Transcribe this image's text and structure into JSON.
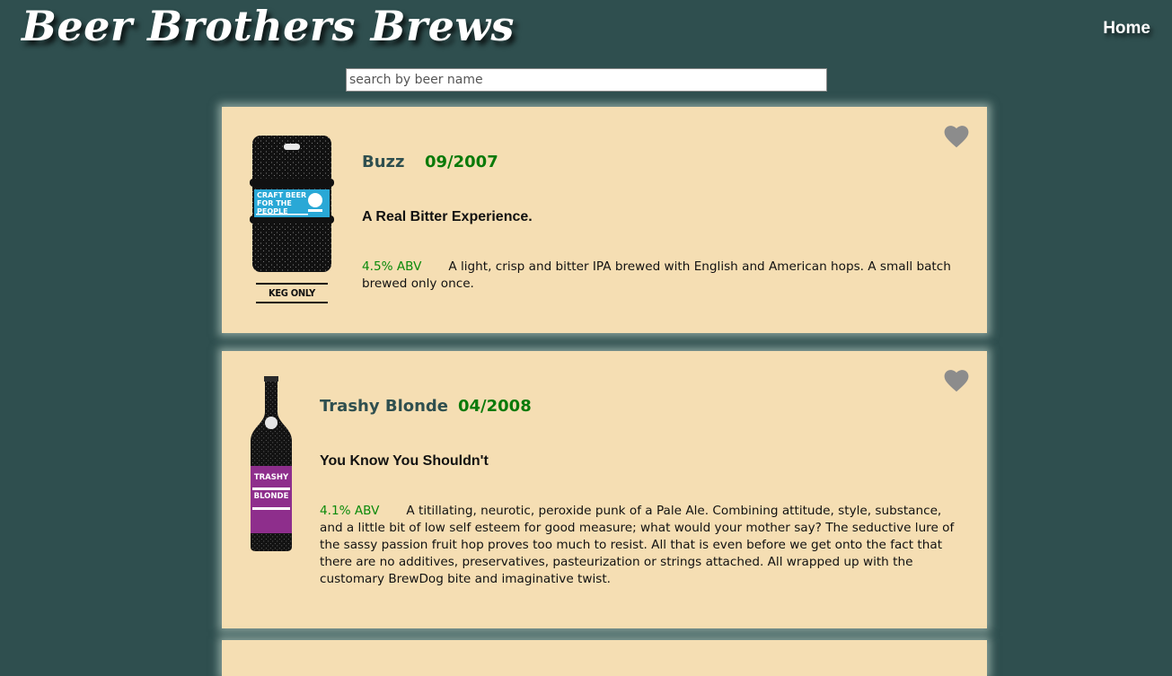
{
  "header": {
    "brand": "Beer Brothers Brews",
    "nav_home": "Home"
  },
  "search": {
    "placeholder": "search by beer name"
  },
  "beers": [
    {
      "name": "Buzz",
      "first_brewed": "09/2007",
      "tagline": "A Real Bitter Experience.",
      "abv": "4.5% ABV",
      "description": "A light, crisp and bitter IPA brewed with English and American hops. A small batch brewed only once.",
      "image_label_lines": [
        "CRAFT BEER",
        "FOR THE",
        "PEOPLE"
      ],
      "image_footer": "KEG ONLY",
      "image_type": "keg",
      "favorite_icon": "heart-icon"
    },
    {
      "name": "Trashy Blonde",
      "first_brewed": "04/2008",
      "tagline": "You Know You Shouldn't",
      "abv": "4.1% ABV",
      "description": "A titillating, neurotic, peroxide punk of a Pale Ale. Combining attitude, style, substance, and a little bit of low self esteem for good measure; what would your mother say? The seductive lure of the sassy passion fruit hop proves too much to resist. All that is even before we get onto the fact that there are no additives, preservatives, pasteurization or strings attached. All wrapped up with the customary BrewDog bite and imaginative twist.",
      "image_label_lines": [
        "TRASHY",
        "BLONDE"
      ],
      "image_type": "bottle",
      "favorite_icon": "heart-icon"
    }
  ],
  "colors": {
    "background": "#2f4f4f",
    "card": "#f5deb3",
    "name": "#2f4f4f",
    "date": "#0a7a0a",
    "heart": "#8c8c8c"
  }
}
